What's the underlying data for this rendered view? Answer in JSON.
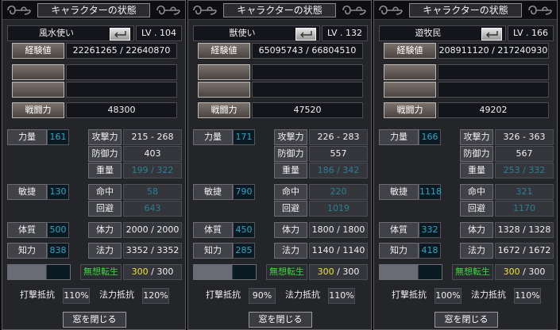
{
  "window_title": "キャラクターの状態",
  "labels": {
    "exp": "経験値",
    "combat": "戦闘力",
    "str": "力量",
    "agi": "敏捷",
    "con": "体質",
    "int": "知力",
    "atk": "攻撃力",
    "def": "防御力",
    "wt": "重量",
    "hit": "命中",
    "eva": "回避",
    "hp": "体力",
    "mp": "法力",
    "reinc": "無想転生",
    "phys_res": "打撃抵抗",
    "mag_res": "法力抵抗",
    "close": "窓を閉じる"
  },
  "chars": [
    {
      "name": "風水使い",
      "level": "LV . 104",
      "exp": "22261265 / 22640870",
      "combat": "48300",
      "str": "161",
      "agi": "130",
      "con": "500",
      "int": "838",
      "atk": "215 - 268",
      "def": "403",
      "weight": "199 / 322",
      "hit": "58",
      "eva": "643",
      "hp": "2000 / 2000",
      "mp": "3352 / 3352",
      "reinc_cur": "300",
      "reinc_max": "/ 300",
      "phys_res": "110%",
      "mag_res": "120%"
    },
    {
      "name": "獣使い",
      "level": "LV . 132",
      "exp": "65095743 / 66804510",
      "combat": "47520",
      "str": "171",
      "agi": "790",
      "con": "450",
      "int": "285",
      "atk": "226 - 283",
      "def": "557",
      "weight": "186 / 342",
      "hit": "220",
      "eva": "1019",
      "hp": "1800 / 1800",
      "mp": "1140 / 1140",
      "reinc_cur": "300",
      "reinc_max": "/ 300",
      "phys_res": "90%",
      "mag_res": "110%"
    },
    {
      "name": "遊牧民",
      "level": "LV . 166",
      "exp": "208911120 / 217240930",
      "combat": "49202",
      "str": "166",
      "agi": "1118",
      "con": "332",
      "int": "418",
      "atk": "326 - 363",
      "def": "567",
      "weight": "253 / 332",
      "hit": "321",
      "eva": "1170",
      "hp": "1328 / 1328",
      "mp": "1672 / 1672",
      "reinc_cur": "300",
      "reinc_max": "/ 300",
      "phys_res": "100%",
      "mag_res": "110%"
    }
  ]
}
